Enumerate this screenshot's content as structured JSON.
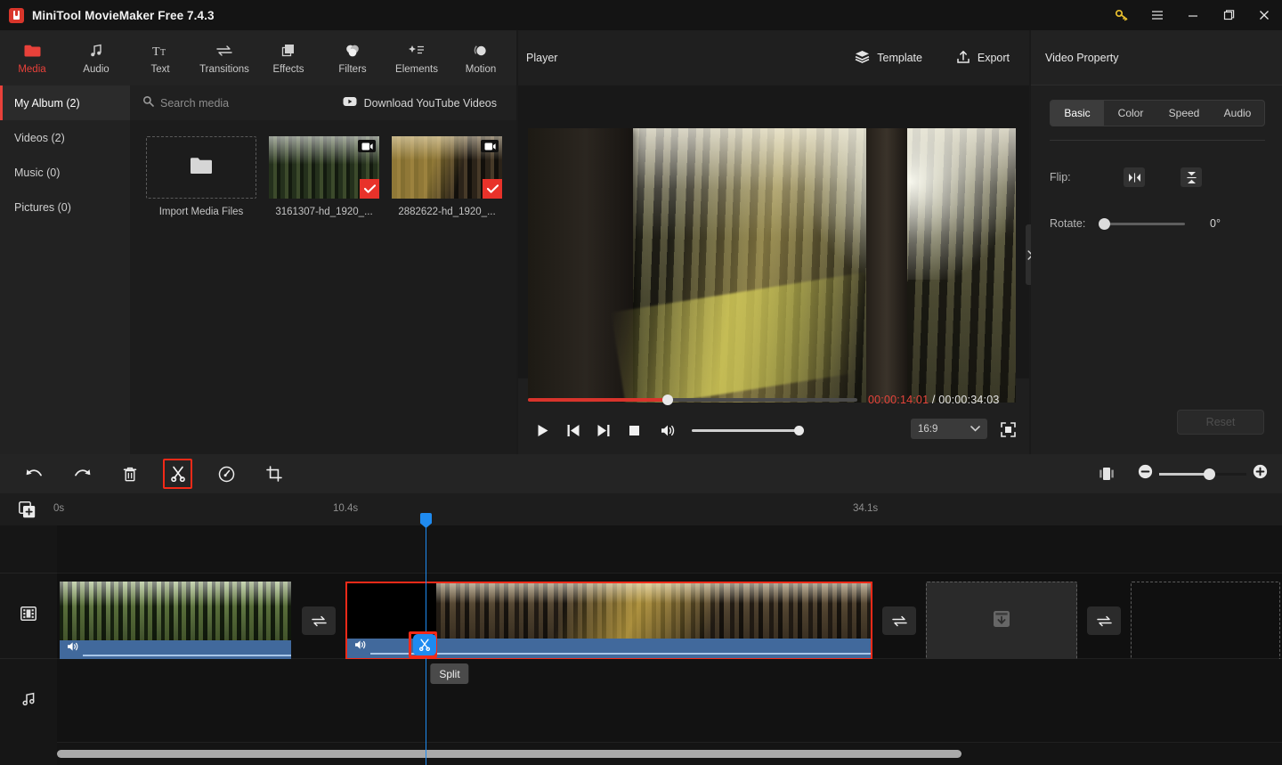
{
  "window": {
    "title": "MiniTool MovieMaker Free 7.4.3",
    "controls": [
      {
        "name": "license-key",
        "icon": "key-icon"
      },
      {
        "name": "menu",
        "icon": "hamburger-menu-icon"
      },
      {
        "name": "minimize",
        "icon": "minimize-icon"
      },
      {
        "name": "maximize",
        "icon": "maximize-icon"
      },
      {
        "name": "close",
        "icon": "close-icon"
      }
    ]
  },
  "tabs": [
    {
      "label": "Media",
      "icon": "folder-icon",
      "active": true
    },
    {
      "label": "Audio",
      "icon": "music-note-icon",
      "active": false
    },
    {
      "label": "Text",
      "icon": "text-icon",
      "active": false
    },
    {
      "label": "Transitions",
      "icon": "transitions-icon",
      "active": false
    },
    {
      "label": "Effects",
      "icon": "effects-icon",
      "active": false
    },
    {
      "label": "Filters",
      "icon": "filters-icon",
      "active": false
    },
    {
      "label": "Elements",
      "icon": "elements-icon",
      "active": false
    },
    {
      "label": "Motion",
      "icon": "motion-icon",
      "active": false
    }
  ],
  "media": {
    "albums": [
      {
        "label": "My Album (2)",
        "active": true
      },
      {
        "label": "Videos (2)",
        "active": false
      },
      {
        "label": "Music (0)",
        "active": false
      },
      {
        "label": "Pictures (0)",
        "active": false
      }
    ],
    "search_placeholder": "Search media",
    "download_youtube": "Download YouTube Videos",
    "import_label": "Import Media Files",
    "items": [
      {
        "name": "3161307-hd_1920_...",
        "selected": true,
        "kind": "video"
      },
      {
        "name": "2882622-hd_1920_...",
        "selected": true,
        "kind": "video"
      }
    ]
  },
  "player": {
    "title": "Player",
    "template_label": "Template",
    "export_label": "Export",
    "current_time": "00:00:14:01",
    "separator": "/",
    "total_time": "00:00:34:03",
    "aspect_ratio": "16:9",
    "seek_percent": 41,
    "volume_percent": 100,
    "buttons": [
      {
        "name": "play",
        "icon": "play-icon"
      },
      {
        "name": "previous-frame",
        "icon": "skip-back-icon"
      },
      {
        "name": "next-frame",
        "icon": "skip-forward-icon"
      },
      {
        "name": "stop",
        "icon": "stop-icon"
      },
      {
        "name": "volume",
        "icon": "speaker-icon"
      }
    ]
  },
  "property": {
    "title": "Video Property",
    "tabs": [
      {
        "label": "Basic",
        "active": true
      },
      {
        "label": "Color",
        "active": false
      },
      {
        "label": "Speed",
        "active": false
      },
      {
        "label": "Audio",
        "active": false
      }
    ],
    "flip_label": "Flip:",
    "rotate_label": "Rotate:",
    "rotate_value": "0°",
    "reset_label": "Reset"
  },
  "edit_toolbar": {
    "buttons": [
      {
        "name": "undo",
        "icon": "undo-arrow-icon",
        "highlighted": false
      },
      {
        "name": "redo",
        "icon": "redo-arrow-icon",
        "highlighted": false
      },
      {
        "name": "delete",
        "icon": "trash-icon",
        "highlighted": false
      },
      {
        "name": "split",
        "icon": "scissors-icon",
        "highlighted": true
      },
      {
        "name": "speed",
        "icon": "speedometer-icon",
        "highlighted": false
      },
      {
        "name": "crop",
        "icon": "crop-icon",
        "highlighted": false
      }
    ],
    "zoom_percent": 55
  },
  "timeline": {
    "add_track_icon": "add-media-icon",
    "ticks": [
      "0s",
      "10.4s",
      "34.1s"
    ],
    "track_icons": [
      "video-track-icon",
      "audio-track-icon"
    ],
    "clips": [
      {
        "name": "clip-1",
        "selected": false
      },
      {
        "name": "clip-2",
        "selected": true
      }
    ],
    "transition_slots": 3,
    "split_tooltip": "Split",
    "split_button_icon": "scissors-icon",
    "playhead_time": "10.4s"
  },
  "colors": {
    "accent_red": "#e8413a",
    "highlight_red": "#f22a18",
    "playhead_blue": "#1f8bf0",
    "audio_bar_blue": "#41699c",
    "key_yellow": "#e8bf2e"
  }
}
